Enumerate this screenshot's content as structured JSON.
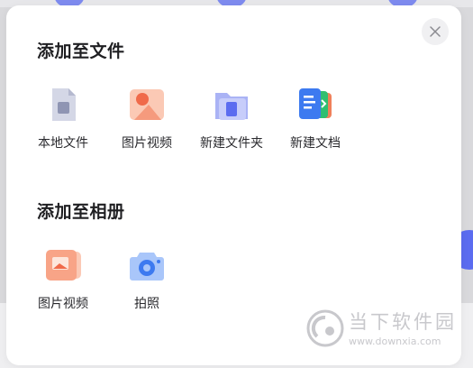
{
  "sheet": {
    "section_files": {
      "title": "添加至文件",
      "items": [
        {
          "label": "本地文件",
          "icon": "local-file-icon"
        },
        {
          "label": "图片视频",
          "icon": "image-video-icon"
        },
        {
          "label": "新建文件夹",
          "icon": "new-folder-icon"
        },
        {
          "label": "新建文档",
          "icon": "new-document-icon"
        }
      ]
    },
    "section_album": {
      "title": "添加至相册",
      "items": [
        {
          "label": "图片视频",
          "icon": "album-image-video-icon"
        },
        {
          "label": "拍照",
          "icon": "camera-icon"
        }
      ]
    },
    "close_icon": "close-icon"
  },
  "watermark": {
    "text": "当下软件园",
    "url": "www.downxia.com"
  },
  "colors": {
    "accent_blue": "#5b6cf0",
    "sheet_bg": "#ffffff",
    "overlay": "#d9d9dc"
  }
}
